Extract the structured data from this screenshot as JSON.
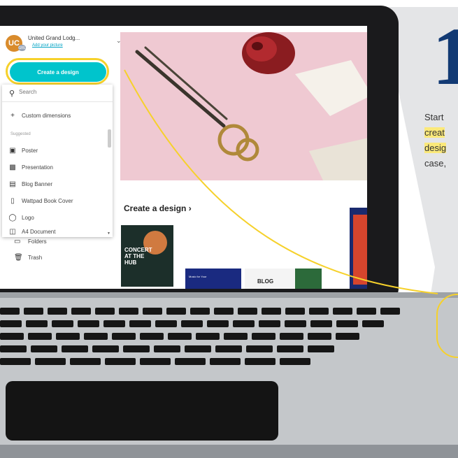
{
  "account": {
    "avatar_initials": "UC",
    "avatar_badge": "GRL",
    "name": "United Grand Lodg...",
    "add_picture": "Add your picture"
  },
  "create_button_label": "Create a design",
  "dropdown": {
    "search_placeholder": "Search",
    "custom_dimensions": "Custom dimensions",
    "suggested_label": "Suggested",
    "items": [
      {
        "label": "Poster",
        "icon": "poster-icon"
      },
      {
        "label": "Presentation",
        "icon": "presentation-icon"
      },
      {
        "label": "Blog Banner",
        "icon": "blog-banner-icon"
      },
      {
        "label": "Wattpad Book Cover",
        "icon": "book-cover-icon"
      },
      {
        "label": "Logo",
        "icon": "logo-icon"
      },
      {
        "label": "A4 Document",
        "icon": "document-icon"
      }
    ]
  },
  "sidebar_items": [
    {
      "label": "Folders",
      "icon": "folder-icon"
    },
    {
      "label": "Trash",
      "icon": "trash-icon"
    }
  ],
  "main": {
    "create_heading": "Create a design",
    "concert_card_text": "CONCERT\nAT THE\nHUB",
    "music_card_text": "Music for Your",
    "blog_card_text": "BLOG"
  },
  "right_panel": {
    "big_glyph": "1",
    "line1": "Start",
    "line2": "creat",
    "line3": "desig",
    "line4": "case,"
  },
  "colors": {
    "accent": "#00c4cc",
    "highlight": "#f6d12b",
    "laptop": "#1a1a1c",
    "navy": "#123a74"
  }
}
